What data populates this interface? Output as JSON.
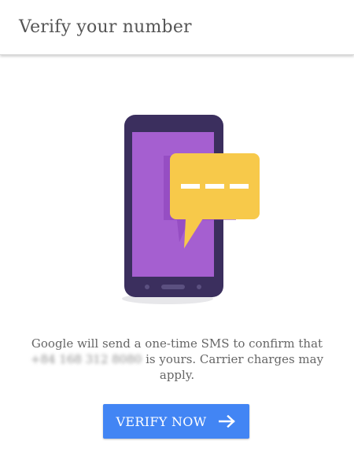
{
  "header": {
    "title": "Verify your number"
  },
  "message": {
    "before_phone": "Google will send a one-time SMS to confirm that",
    "phone_number": "+84 168 312 8080",
    "after_phone": " is yours. Carrier charges may apply."
  },
  "verify_button": {
    "label": "VERIFY NOW",
    "icon": "arrow-right-icon"
  },
  "colors": {
    "accent": "#4285f4",
    "phone_body": "#3b2f5e",
    "phone_screen": "#a55fd0",
    "bubble": "#f7c94a"
  }
}
